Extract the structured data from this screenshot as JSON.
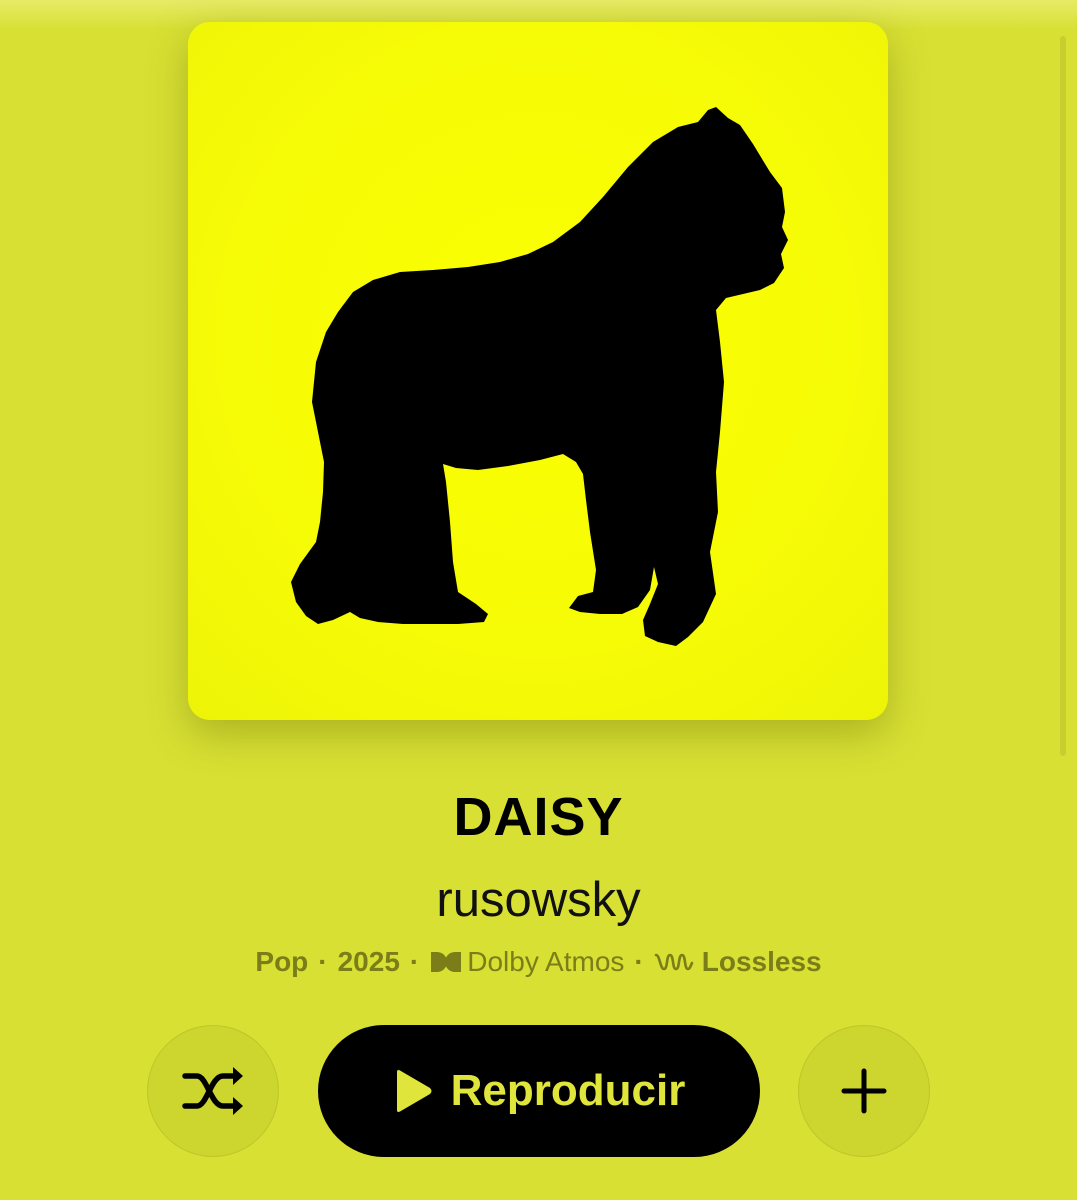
{
  "album": {
    "title": "DAISY",
    "artist": "rusowsky",
    "artwork_subject": "gorilla silhouette",
    "artwork_bg_color": "#f8fc00"
  },
  "meta": {
    "genre": "Pop",
    "separator": "·",
    "year": "2025",
    "dolby_label": "Dolby Atmos",
    "lossless_label": "Lossless"
  },
  "controls": {
    "shuffle_icon": "shuffle-icon",
    "play_icon": "play-icon",
    "play_label": "Reproducir",
    "add_icon": "plus-icon"
  },
  "colors": {
    "background": "#d8e033",
    "button_bg": "#cdd52f",
    "play_bg": "#000000",
    "play_text": "#dfe53a",
    "meta_text": "#7a7d18"
  }
}
